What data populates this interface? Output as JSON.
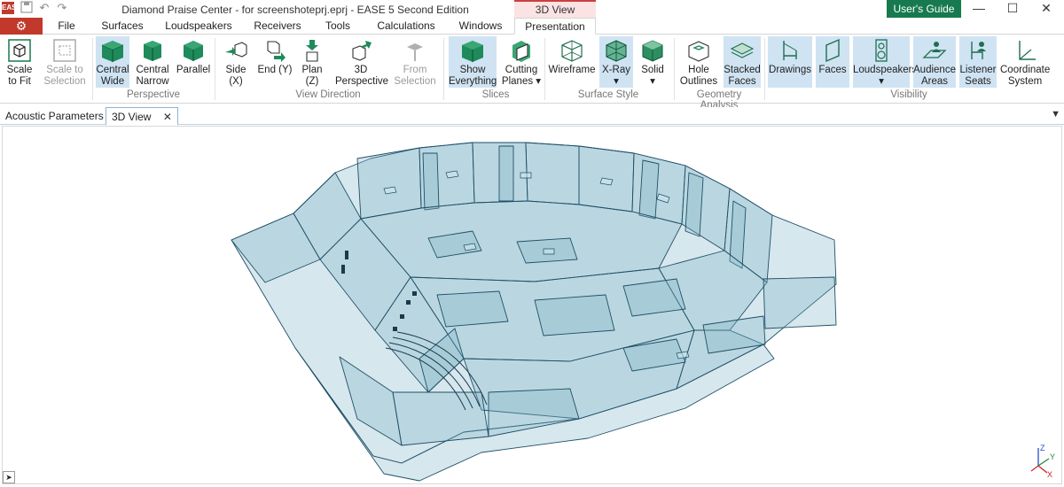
{
  "titlebar": {
    "logo": "EASE",
    "title": "Diamond Praise Center - for screenshoteprj.eprj - EASE 5 Second Edition",
    "context_tab": "3D View",
    "users_guide": "User's Guide",
    "minimize": "—",
    "maximize": "☐",
    "close": "✕"
  },
  "tabs": [
    "File",
    "Surfaces",
    "Loudspeakers",
    "Receivers",
    "Tools",
    "Calculations",
    "Windows",
    "Presentation"
  ],
  "active_tab": "Presentation",
  "ribbon": {
    "buttons": {
      "scale_to_fit": "Scale\nto Fit",
      "scale_to_selection": "Scale to\nSelection",
      "central_wide": "Central\nWide",
      "central_narrow": "Central\nNarrow",
      "parallel": "Parallel",
      "side_x": "Side (X)",
      "end_y": "End (Y)",
      "plan_z": "Plan (Z)",
      "perspective_3d": "3D\nPerspective",
      "from_selection": "From\nSelection",
      "show_everything": "Show\nEverything",
      "cutting_planes": "Cutting\nPlanes ▾",
      "wireframe": "Wireframe",
      "xray": "X-Ray\n▾",
      "solid": "Solid\n▾",
      "hole_outlines": "Hole\nOutlines",
      "stacked_faces": "Stacked\nFaces",
      "drawings": "Drawings",
      "faces": "Faces",
      "loudspeakers": "Loudspeakers\n▾",
      "audience_areas": "Audience\nAreas",
      "listener_seats": "Listener\nSeats",
      "coordinate_system": "Coordinate\nSystem"
    },
    "groups": {
      "perspective": "Perspective",
      "view_direction": "View Direction",
      "slices": "Slices",
      "surface_style": "Surface Style",
      "geometry_analysis": "Geometry Analysis",
      "visibility": "Visibility"
    }
  },
  "doc_tabs": {
    "acoustic_parameters": "Acoustic Parameters",
    "view_3d": "3D View",
    "close": "✕",
    "menu": "▼"
  },
  "axes": {
    "z": "Z",
    "y": "Y",
    "x": "X"
  },
  "colors": {
    "accent_red": "#c0392b",
    "guide_green": "#177a4e",
    "selected_blue": "#cfe3f3",
    "model_fill": "#7fb3c8",
    "model_stroke": "#1f4f66"
  }
}
